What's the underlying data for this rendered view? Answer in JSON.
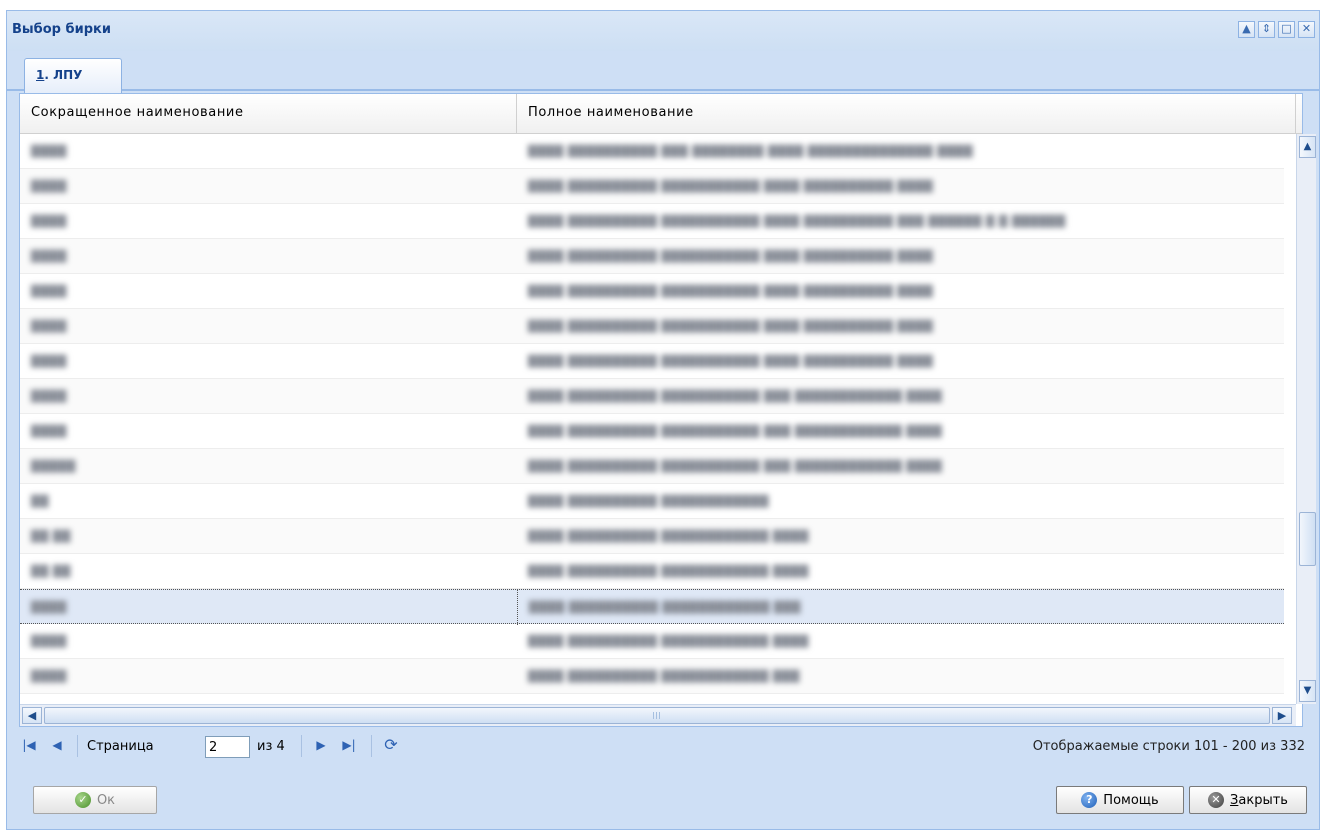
{
  "window": {
    "title": "Выбор бирки",
    "tools": [
      "▲",
      "⇕",
      "□",
      "✕"
    ]
  },
  "tabs": [
    {
      "number": "1",
      "rest": ". ЛПУ"
    }
  ],
  "grid": {
    "columns": [
      "Сокращенное наименование",
      "Полное наименование"
    ],
    "rows": [
      {
        "short": "████ ",
        "full": "████ ██████████ ███ ████████ ████ ██████████████ ████"
      },
      {
        "short": "████ ",
        "full": "████ ██████████ ███████████ ████ ██████████ ████"
      },
      {
        "short": "████ ",
        "full": "████ ██████████ ███████████ ████ ██████████ ███ ██████ █ █ ██████"
      },
      {
        "short": "████ ",
        "full": "████ ██████████ ███████████ ████ ██████████ ████"
      },
      {
        "short": "████ ",
        "full": "████ ██████████ ███████████ ████ ██████████ ████"
      },
      {
        "short": "████ ",
        "full": "████ ██████████ ███████████ ████ ██████████ ████"
      },
      {
        "short": "████ ",
        "full": "████ ██████████ ███████████ ████ ██████████ ████"
      },
      {
        "short": "████ ",
        "full": "████ ██████████ ███████████ ███ ████████████ ████"
      },
      {
        "short": "████ ",
        "full": "████ ██████████ ███████████ ███ ████████████ ████"
      },
      {
        "short": "█████",
        "full": "████ ██████████ ███████████ ███ ████████████ ████"
      },
      {
        "short": "██",
        "full": "████ ██████████ ████████████"
      },
      {
        "short": "██ ██",
        "full": "████ ██████████ ████████████ ████"
      },
      {
        "short": "██ ██",
        "full": "████ ██████████ ████████████ ████"
      },
      {
        "short": "████",
        "full": "████ ██████████ ████████████ ███"
      },
      {
        "short": "████",
        "full": "████ ██████████ ████████████ ████"
      },
      {
        "short": "████",
        "full": "████ ██████████ ████████████ ███"
      }
    ],
    "selected_row": 13
  },
  "pager": {
    "page_label": "Страница",
    "page_value": "2",
    "of_label": "из 4",
    "info": "Отображаемые строки 101 - 200 из 332"
  },
  "footer": {
    "ok_label": "Ок",
    "help_label": "Помощь",
    "close_mnemonic": "З",
    "close_rest": "акрыть"
  },
  "icons": {
    "first_page": "first-page-icon",
    "prev_page": "prev-page-icon",
    "next_page": "next-page-icon",
    "last_page": "last-page-icon",
    "refresh": "refresh-icon"
  }
}
